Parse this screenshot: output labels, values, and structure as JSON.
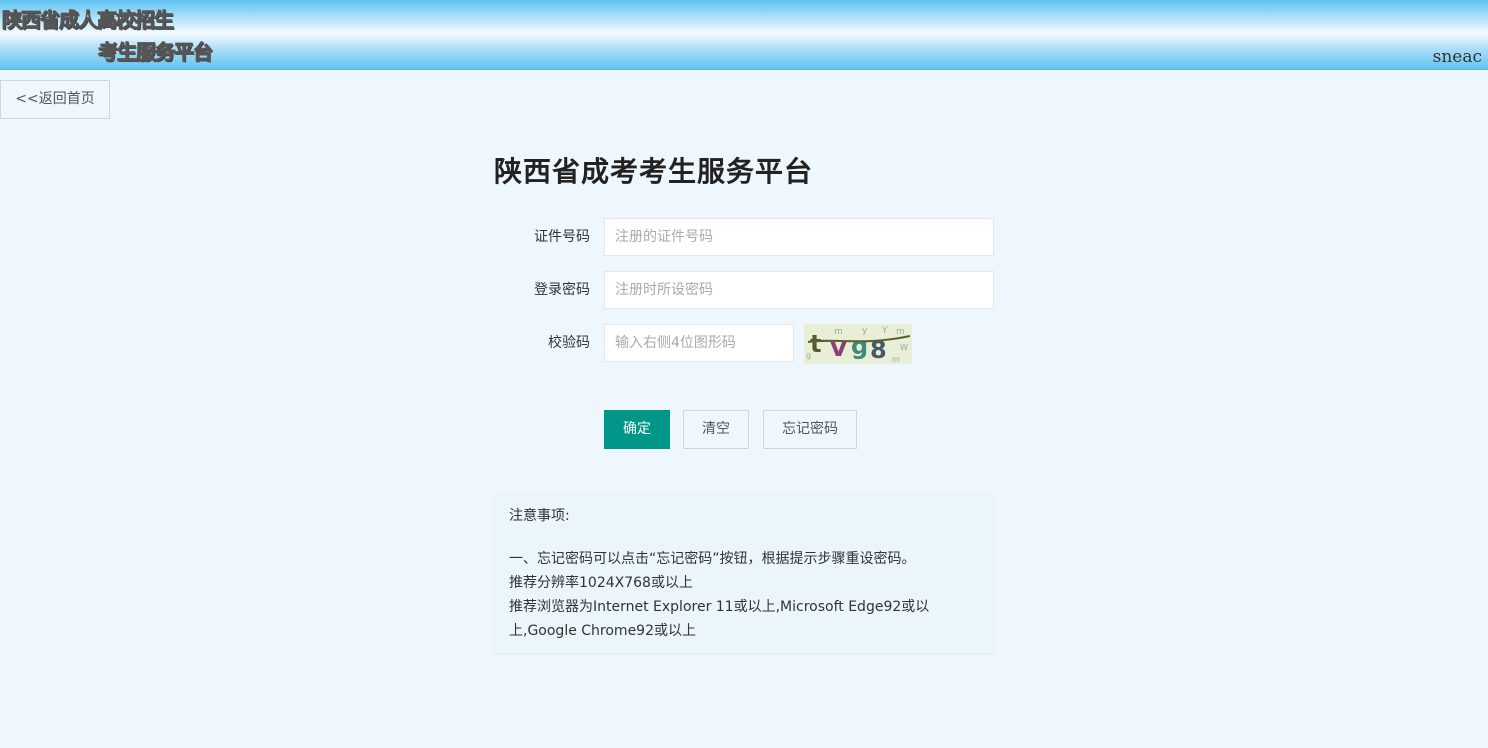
{
  "header": {
    "logo_line1": "陕西省成人高校招生",
    "logo_line2": "考生服务平台",
    "right_text": "sneac"
  },
  "back_button": "<<返回首页",
  "page_title": "陕西省成考考生服务平台",
  "form": {
    "id_label": "证件号码",
    "id_placeholder": "注册的证件号码",
    "password_label": "登录密码",
    "password_placeholder": "注册时所设密码",
    "captcha_label": "校验码",
    "captcha_placeholder": "输入右侧4位图形码",
    "captcha_text": "tvg8"
  },
  "buttons": {
    "confirm": "确定",
    "clear": "清空",
    "forgot": "忘记密码"
  },
  "notice": {
    "title": "注意事项:",
    "lines": [
      "一、忘记密码可以点击“忘记密码”按钮，根据提示步骤重设密码。",
      "推荐分辨率1024X768或以上",
      "推荐浏览器为Internet Explorer 11或以上,Microsoft Edge92或以上,Google Chrome92或以上"
    ]
  },
  "colors": {
    "primary": "#009688",
    "background": "#eef7fd",
    "header_blue": "#5ec2f2"
  }
}
